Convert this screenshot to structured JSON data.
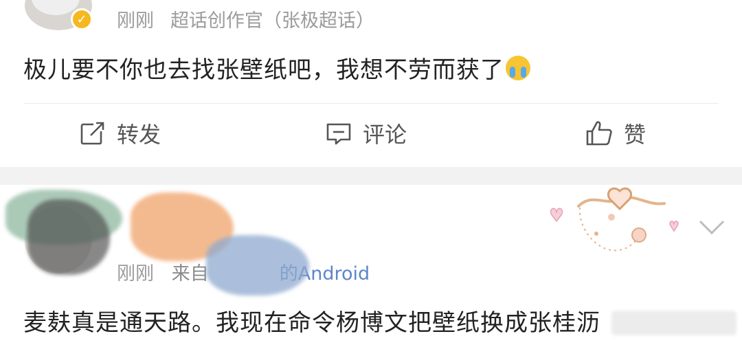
{
  "post1": {
    "time": "刚刚",
    "source": "超话创作官（张极超话）",
    "text": "极儿要不你也去找张壁纸吧，我想不劳而获了",
    "emoji_icon": "crying-face-icon"
  },
  "actions": {
    "repost": "转发",
    "comment": "评论",
    "like": "赞"
  },
  "post2": {
    "time": "刚刚",
    "from_label": "来自",
    "device": "的Android",
    "text": "麦麸真是通天路。我现在命令杨博文把壁纸换成张桂沥"
  },
  "colors": {
    "verified_badge": "#f5b81e",
    "link_blue": "#5e85c9",
    "meta_gray": "#9b9b9b",
    "text": "#222222"
  }
}
